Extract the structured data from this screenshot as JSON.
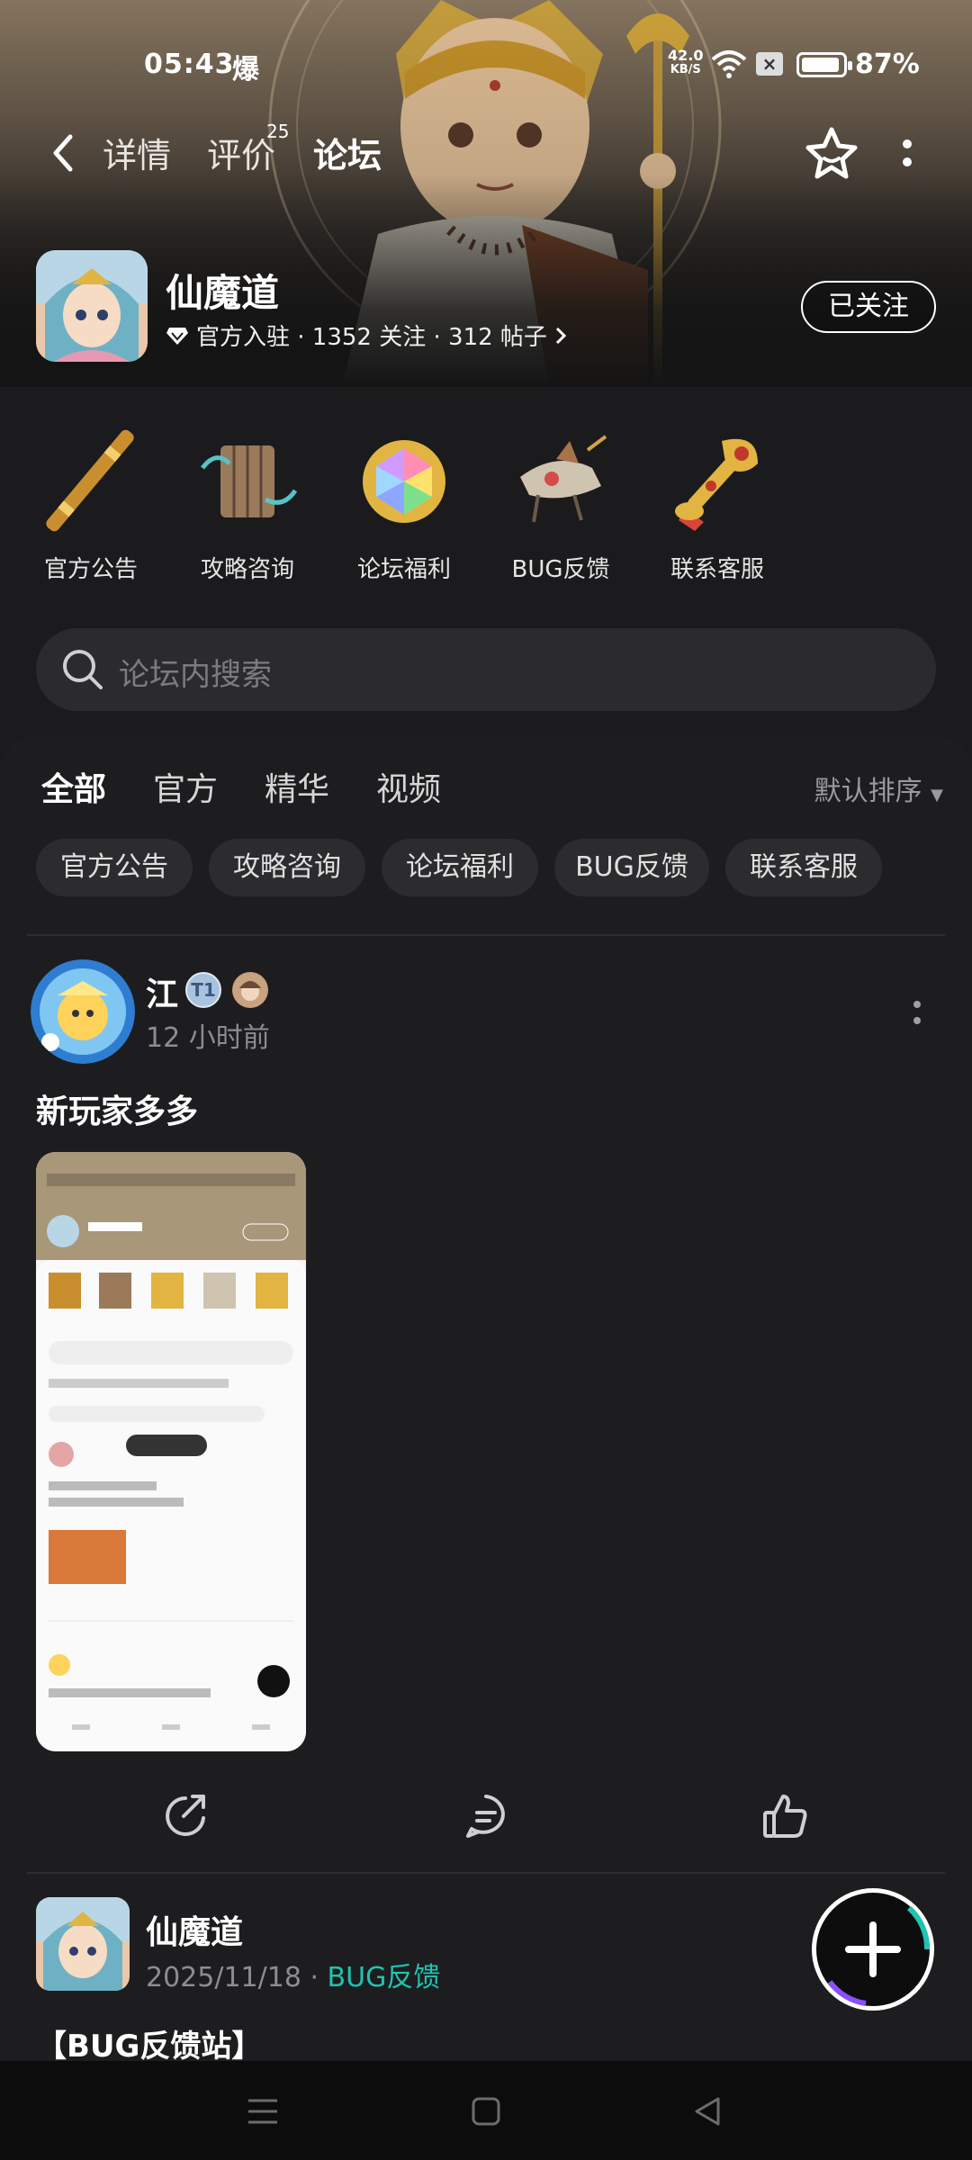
{
  "status_bar": {
    "time": "05:43",
    "boom_icon": "爆",
    "net_speed_value": "42.0",
    "net_speed_unit": "KB/S",
    "battery_percent": "87%",
    "battery_level": 0.87
  },
  "nav": {
    "tabs": [
      {
        "label": "详情"
      },
      {
        "label": "评价",
        "badge": "25"
      },
      {
        "label": "论坛"
      }
    ],
    "active_tab": "论坛"
  },
  "game": {
    "name": "仙魔道",
    "meta": "官方入驻 · 1352 关注 · 312 帖子",
    "follow_label": "已关注"
  },
  "categories": [
    {
      "label": "官方公告",
      "icon": "scroll-staff-icon"
    },
    {
      "label": "攻略咨询",
      "icon": "bamboo-scroll-icon"
    },
    {
      "label": "论坛福利",
      "icon": "rainbow-gem-icon"
    },
    {
      "label": "BUG反馈",
      "icon": "gourd-mech-icon"
    },
    {
      "label": "联系客服",
      "icon": "ruyi-scepter-icon"
    }
  ],
  "search": {
    "placeholder": "论坛内搜索"
  },
  "filter_tabs": [
    {
      "label": "全部"
    },
    {
      "label": "官方"
    },
    {
      "label": "精华"
    },
    {
      "label": "视频"
    }
  ],
  "sort_label": "默认排序",
  "chips": [
    {
      "label": "官方公告"
    },
    {
      "label": "攻略咨询"
    },
    {
      "label": "论坛福利"
    },
    {
      "label": "BUG反馈"
    },
    {
      "label": "联系客服"
    }
  ],
  "posts": [
    {
      "author": "江",
      "badge": "T1",
      "time": "12 小时前",
      "title": "新玩家多多"
    },
    {
      "author": "仙魔道",
      "date": "2025/11/18",
      "separator": " · ",
      "tag": "BUG反馈",
      "title": "【BUG反馈站】"
    }
  ],
  "colors": {
    "accent": "#1fc4b0",
    "background": "#1d1d1f",
    "chip_bg": "#2c2c2f",
    "muted_text": "#8d8d91"
  }
}
